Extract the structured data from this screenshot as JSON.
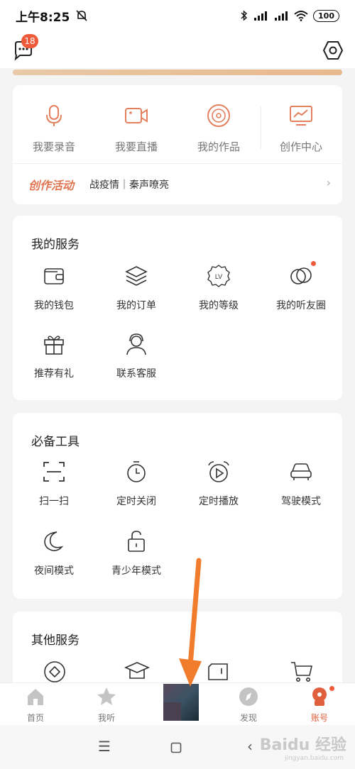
{
  "status_bar": {
    "time": "上午8:25",
    "battery": "100"
  },
  "header": {
    "message_count": "18"
  },
  "create": {
    "items": [
      {
        "label": "我要录音",
        "icon": "microphone-icon"
      },
      {
        "label": "我要直播",
        "icon": "video-camera-icon"
      },
      {
        "label": "我的作品",
        "icon": "vinyl-record-icon"
      },
      {
        "label": "创作中心",
        "icon": "monitor-chart-icon"
      }
    ],
    "activity_tag": "创作活动",
    "activity_text": "战疫情｜秦声嘹亮"
  },
  "services": {
    "title": "我的服务",
    "items": [
      {
        "label": "我的钱包",
        "icon": "wallet-icon"
      },
      {
        "label": "我的订单",
        "icon": "layers-icon"
      },
      {
        "label": "我的等级",
        "icon": "level-badge-icon"
      },
      {
        "label": "我的听友圈",
        "icon": "circles-icon"
      },
      {
        "label": "推荐有礼",
        "icon": "gift-icon"
      },
      {
        "label": "联系客服",
        "icon": "headset-agent-icon"
      }
    ]
  },
  "tools": {
    "title": "必备工具",
    "items": [
      {
        "label": "扫一扫",
        "icon": "scan-icon"
      },
      {
        "label": "定时关闭",
        "icon": "timer-icon"
      },
      {
        "label": "定时播放",
        "icon": "alarm-play-icon"
      },
      {
        "label": "驾驶模式",
        "icon": "car-icon"
      },
      {
        "label": "夜间模式",
        "icon": "moon-icon"
      },
      {
        "label": "青少年模式",
        "icon": "lock-icon"
      }
    ]
  },
  "other": {
    "title": "其他服务"
  },
  "bottom_nav": {
    "items": [
      {
        "label": "首页",
        "icon": "home-icon"
      },
      {
        "label": "我听",
        "icon": "star-icon"
      },
      {
        "label": "发现",
        "icon": "compass-icon"
      },
      {
        "label": "账号",
        "icon": "account-icon"
      }
    ]
  },
  "watermark": {
    "text": "Baidu 经验",
    "sub": "jingyan.baidu.com"
  },
  "colors": {
    "accent": "#e0603e",
    "badge": "#ee5a3a",
    "arrow": "#f07c2c"
  }
}
